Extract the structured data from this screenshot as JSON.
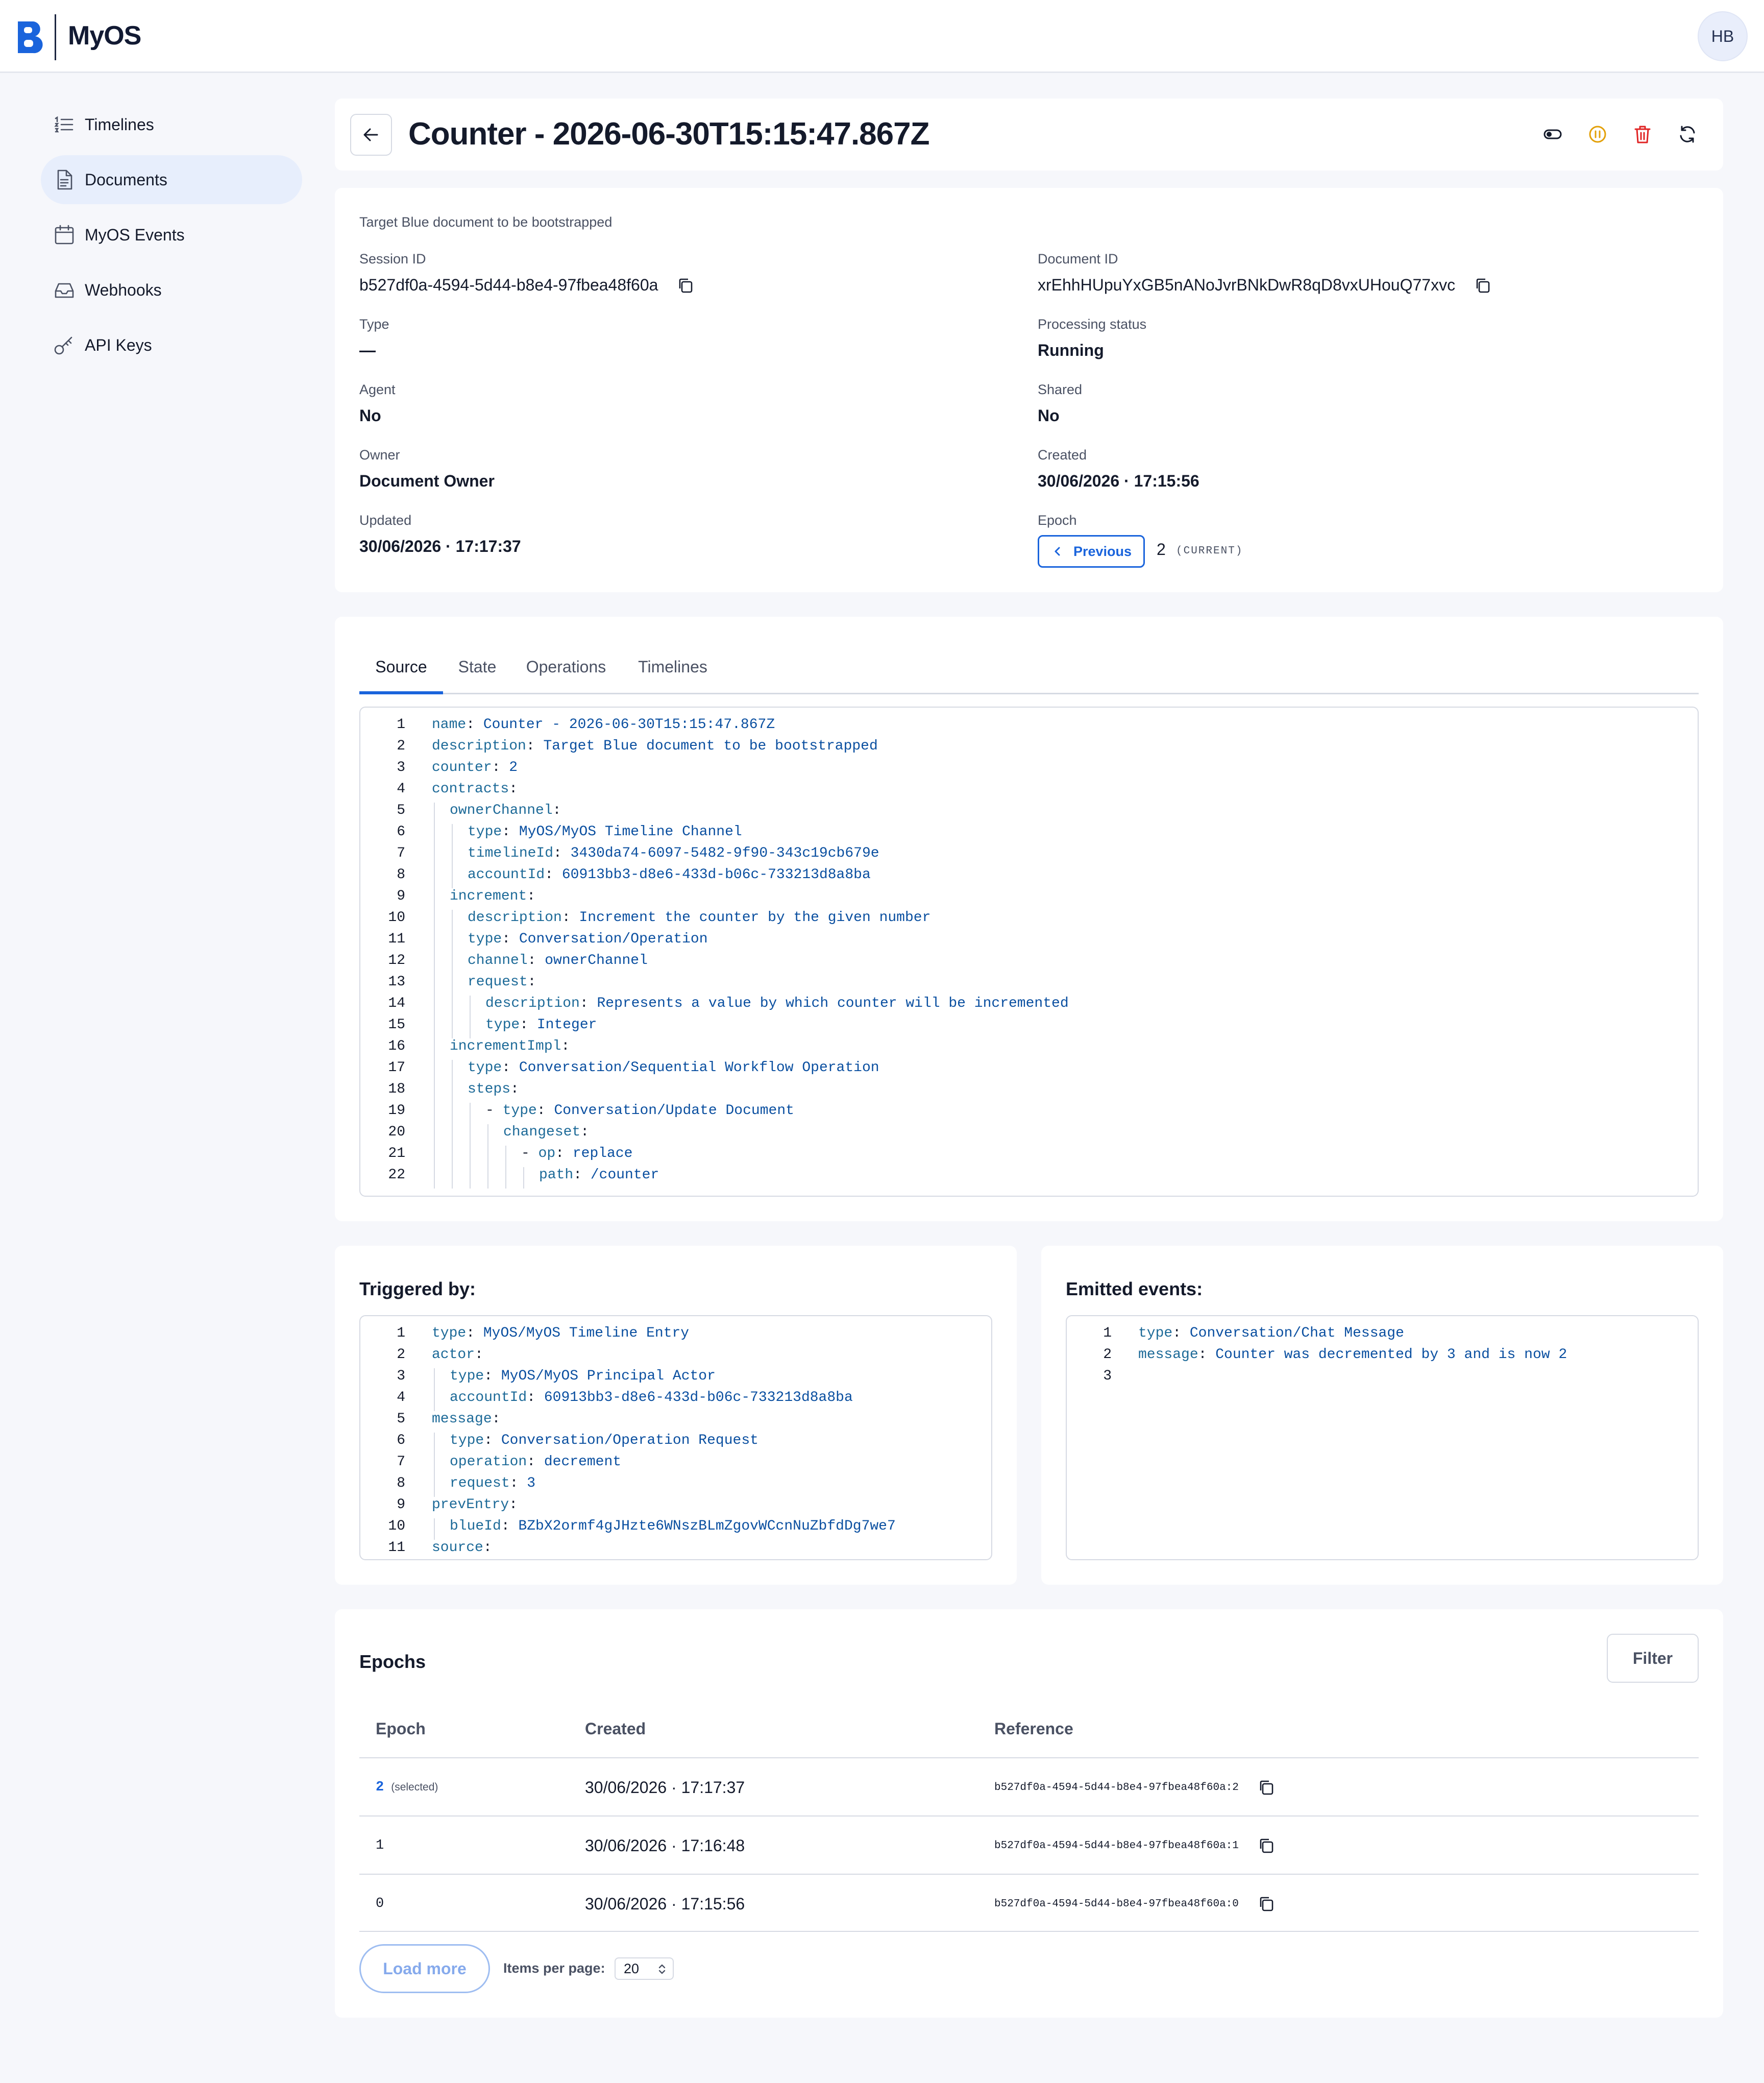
{
  "app": {
    "name": "MyOS",
    "user_initials": "HB"
  },
  "sidebar": {
    "items": [
      {
        "label": "Timelines",
        "icon": "list-icon",
        "active": false
      },
      {
        "label": "Documents",
        "icon": "document-icon",
        "active": true
      },
      {
        "label": "MyOS Events",
        "icon": "calendar-icon",
        "active": false
      },
      {
        "label": "Webhooks",
        "icon": "inbox-icon",
        "active": false
      },
      {
        "label": "API Keys",
        "icon": "key-icon",
        "active": false
      }
    ]
  },
  "header": {
    "title": "Counter - 2026-06-30T15:15:47.867Z",
    "actions": [
      "toggle-icon",
      "pause-icon",
      "trash-icon",
      "refresh-icon"
    ],
    "colors": {
      "pause": "#e3a008",
      "trash": "#e02424",
      "accent": "#1a64dc"
    }
  },
  "info": {
    "subtitle": "Target Blue document to be bootstrapped",
    "session_id_label": "Session ID",
    "session_id": "b527df0a-4594-5d44-b8e4-97fbea48f60a",
    "document_id_label": "Document ID",
    "document_id": "xrEhhHUpuYxGB5nANoJvrBNkDwR8qD8vxUHouQ77xvc",
    "type_label": "Type",
    "type": "—",
    "processing_status_label": "Processing status",
    "processing_status": "Running",
    "agent_label": "Agent",
    "agent": "No",
    "shared_label": "Shared",
    "shared": "No",
    "owner_label": "Owner",
    "owner": "Document Owner",
    "created_label": "Created",
    "created": "30/06/2026 · 17:15:56",
    "updated_label": "Updated",
    "updated": "30/06/2026 · 17:17:37",
    "epoch_label": "Epoch",
    "previous_label": "Previous",
    "epoch_value": "2",
    "epoch_current": "(CURRENT)"
  },
  "tabs": [
    {
      "label": "Source",
      "active": true
    },
    {
      "label": "State",
      "active": false
    },
    {
      "label": "Operations",
      "active": false
    },
    {
      "label": "Timelines",
      "active": false
    }
  ],
  "source_code": [
    {
      "n": "1",
      "depth": 0,
      "dash": false,
      "key": "name",
      "value": "Counter - 2026-06-30T15:15:47.867Z"
    },
    {
      "n": "2",
      "depth": 0,
      "dash": false,
      "key": "description",
      "value": "Target Blue document to be bootstrapped"
    },
    {
      "n": "3",
      "depth": 0,
      "dash": false,
      "key": "counter",
      "value": "2"
    },
    {
      "n": "4",
      "depth": 0,
      "dash": false,
      "key": "contracts",
      "value": ""
    },
    {
      "n": "5",
      "depth": 1,
      "dash": false,
      "key": "ownerChannel",
      "value": ""
    },
    {
      "n": "6",
      "depth": 2,
      "dash": false,
      "key": "type",
      "value": "MyOS/MyOS Timeline Channel"
    },
    {
      "n": "7",
      "depth": 2,
      "dash": false,
      "key": "timelineId",
      "value": "3430da74-6097-5482-9f90-343c19cb679e"
    },
    {
      "n": "8",
      "depth": 2,
      "dash": false,
      "key": "accountId",
      "value": "60913bb3-d8e6-433d-b06c-733213d8a8ba"
    },
    {
      "n": "9",
      "depth": 1,
      "dash": false,
      "key": "increment",
      "value": ""
    },
    {
      "n": "10",
      "depth": 2,
      "dash": false,
      "key": "description",
      "value": "Increment the counter by the given number"
    },
    {
      "n": "11",
      "depth": 2,
      "dash": false,
      "key": "type",
      "value": "Conversation/Operation"
    },
    {
      "n": "12",
      "depth": 2,
      "dash": false,
      "key": "channel",
      "value": "ownerChannel"
    },
    {
      "n": "13",
      "depth": 2,
      "dash": false,
      "key": "request",
      "value": ""
    },
    {
      "n": "14",
      "depth": 3,
      "dash": false,
      "key": "description",
      "value": "Represents a value by which counter will be incremented"
    },
    {
      "n": "15",
      "depth": 3,
      "dash": false,
      "key": "type",
      "value": "Integer"
    },
    {
      "n": "16",
      "depth": 1,
      "dash": false,
      "key": "incrementImpl",
      "value": ""
    },
    {
      "n": "17",
      "depth": 2,
      "dash": false,
      "key": "type",
      "value": "Conversation/Sequential Workflow Operation"
    },
    {
      "n": "18",
      "depth": 2,
      "dash": false,
      "key": "steps",
      "value": ""
    },
    {
      "n": "19",
      "depth": 3,
      "dash": true,
      "key": "type",
      "value": "Conversation/Update Document"
    },
    {
      "n": "20",
      "depth": 4,
      "dash": false,
      "key": "changeset",
      "value": ""
    },
    {
      "n": "21",
      "depth": 5,
      "dash": true,
      "key": "op",
      "value": "replace"
    },
    {
      "n": "22",
      "depth": 6,
      "dash": false,
      "key": "path",
      "value": "/counter"
    }
  ],
  "triggered_by": {
    "title": "Triggered by:",
    "code": [
      {
        "n": "1",
        "depth": 0,
        "dash": false,
        "key": "type",
        "value": "MyOS/MyOS Timeline Entry"
      },
      {
        "n": "2",
        "depth": 0,
        "dash": false,
        "key": "actor",
        "value": ""
      },
      {
        "n": "3",
        "depth": 1,
        "dash": false,
        "key": "type",
        "value": "MyOS/MyOS Principal Actor"
      },
      {
        "n": "4",
        "depth": 1,
        "dash": false,
        "key": "accountId",
        "value": "60913bb3-d8e6-433d-b06c-733213d8a8ba"
      },
      {
        "n": "5",
        "depth": 0,
        "dash": false,
        "key": "message",
        "value": ""
      },
      {
        "n": "6",
        "depth": 1,
        "dash": false,
        "key": "type",
        "value": "Conversation/Operation Request"
      },
      {
        "n": "7",
        "depth": 1,
        "dash": false,
        "key": "operation",
        "value": "decrement"
      },
      {
        "n": "8",
        "depth": 1,
        "dash": false,
        "key": "request",
        "value": "3"
      },
      {
        "n": "9",
        "depth": 0,
        "dash": false,
        "key": "prevEntry",
        "value": ""
      },
      {
        "n": "10",
        "depth": 1,
        "dash": false,
        "key": "blueId",
        "value": "BZbX2ormf4gJHzte6WNszBLmZgovWCcnNuZbfdDg7we7"
      },
      {
        "n": "11",
        "depth": 0,
        "dash": false,
        "key": "source",
        "value": ""
      }
    ]
  },
  "emitted_events": {
    "title": "Emitted events:",
    "code": [
      {
        "n": "1",
        "depth": 0,
        "dash": false,
        "key": "type",
        "value": "Conversation/Chat Message"
      },
      {
        "n": "2",
        "depth": 0,
        "dash": false,
        "key": "message",
        "value": "Counter was decremented by 3 and is now 2"
      },
      {
        "n": "3",
        "depth": 0,
        "dash": false,
        "key": "",
        "value": ""
      }
    ]
  },
  "epochs": {
    "title": "Epochs",
    "filter_label": "Filter",
    "columns": [
      "Epoch",
      "Created",
      "Reference"
    ],
    "rows": [
      {
        "epoch": "2",
        "selected_tag": "(selected)",
        "created": "30/06/2026 · 17:17:37",
        "reference": "b527df0a-4594-5d44-b8e4-97fbea48f60a:2"
      },
      {
        "epoch": "1",
        "selected_tag": "",
        "created": "30/06/2026 · 17:16:48",
        "reference": "b527df0a-4594-5d44-b8e4-97fbea48f60a:1"
      },
      {
        "epoch": "0",
        "selected_tag": "",
        "created": "30/06/2026 · 17:15:56",
        "reference": "b527df0a-4594-5d44-b8e4-97fbea48f60a:0"
      }
    ],
    "load_more_label": "Load more",
    "items_per_page_label": "Items per page:",
    "items_per_page": "20"
  }
}
